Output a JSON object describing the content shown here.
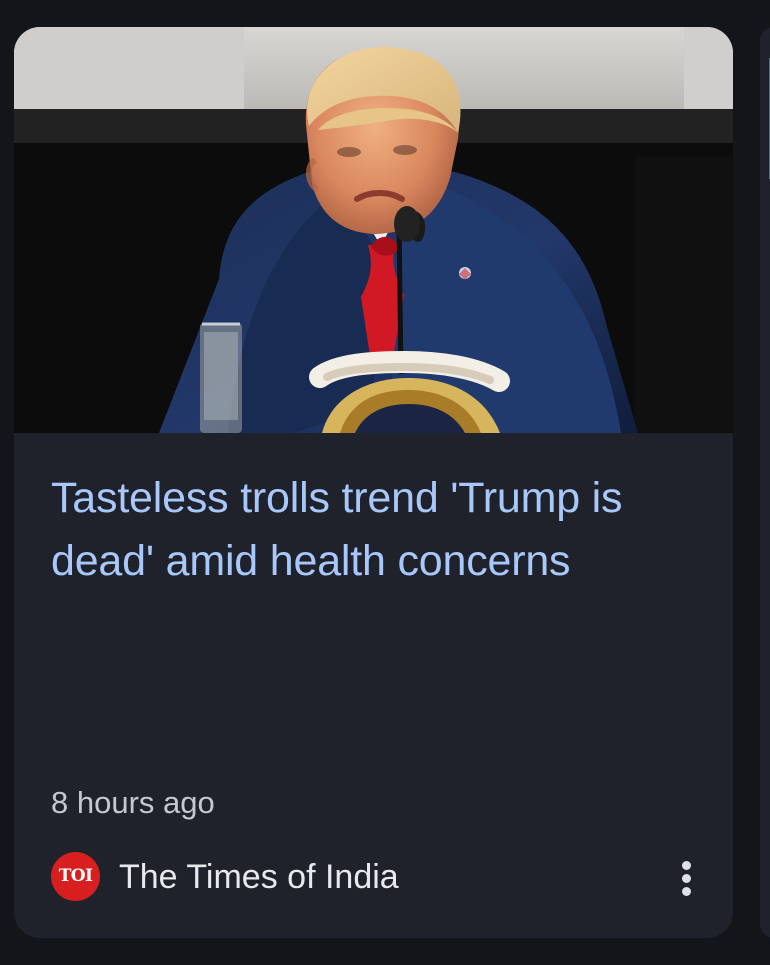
{
  "article": {
    "headline": "Tasteless trolls trend 'Trump is dead' amid health concerns",
    "time_ago": "8 hours ago",
    "image": {
      "subject": "Trump speaking at a microphone with a presidential seal and a glass of water"
    }
  },
  "source": {
    "logo_text": "TOI",
    "name": "The Times of India"
  },
  "icons": {
    "more": "more-vertical-icon",
    "source_logo": "times-of-india-logo"
  },
  "colors": {
    "page_background": "#13151b",
    "card_background": "#1f222b",
    "headline": "#a8c7fa",
    "meta_text": "#c6c8cf",
    "source_text": "#e8e9ee",
    "logo_red": "#d71f1f"
  }
}
